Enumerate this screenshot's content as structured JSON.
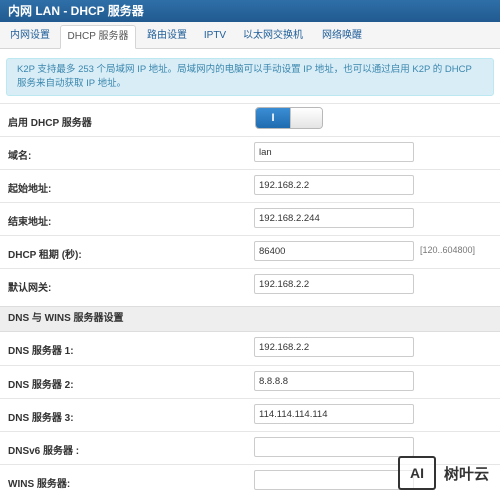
{
  "window": {
    "title": "内网 LAN - DHCP 服务器"
  },
  "tabs": [
    {
      "label": "内网设置",
      "active": false
    },
    {
      "label": "DHCP 服务器",
      "active": true
    },
    {
      "label": "路由设置",
      "active": false
    },
    {
      "label": "IPTV",
      "active": false
    },
    {
      "label": "以太网交换机",
      "active": false
    },
    {
      "label": "网络唤醒",
      "active": false
    }
  ],
  "info": {
    "text": "K2P 支持最多 253 个局域网 IP 地址。局域网内的电脑可以手动设置 IP 地址，也可以通过启用 K2P 的 DHCP 服务来自动获取 IP 地址。"
  },
  "dhcp": {
    "enable_label": "启用 DHCP 服务器",
    "toggle_on_glyph": "I",
    "enabled": true
  },
  "fields": {
    "domain": {
      "label": "域名:",
      "value": "lan"
    },
    "start_ip": {
      "label": "起始地址:",
      "value": "192.168.2.2"
    },
    "end_ip": {
      "label": "结束地址:",
      "value": "192.168.2.244"
    },
    "lease": {
      "label": "DHCP 租期 (秒):",
      "value": "86400",
      "hint": "[120..604800]"
    },
    "gateway": {
      "label": "默认网关:",
      "value": "192.168.2.2"
    }
  },
  "dns_section": {
    "title": "DNS 与 WINS 服务器设置",
    "dns1": {
      "label": "DNS 服务器 1:",
      "value": "192.168.2.2"
    },
    "dns2": {
      "label": "DNS 服务器 2:",
      "value": "8.8.8.8"
    },
    "dns3": {
      "label": "DNS 服务器 3:",
      "value": "114.114.114.114"
    },
    "dnsv6": {
      "label": "DNSv6 服务器 :",
      "value": ""
    },
    "wins": {
      "label": "WINS 服务器:",
      "value": ""
    }
  },
  "watermark": {
    "logo": "AI",
    "text": "树叶云"
  },
  "colors": {
    "accent": "#205a8f",
    "info_bg": "#d9edf7",
    "toggle_on": "#1f6bb0"
  }
}
